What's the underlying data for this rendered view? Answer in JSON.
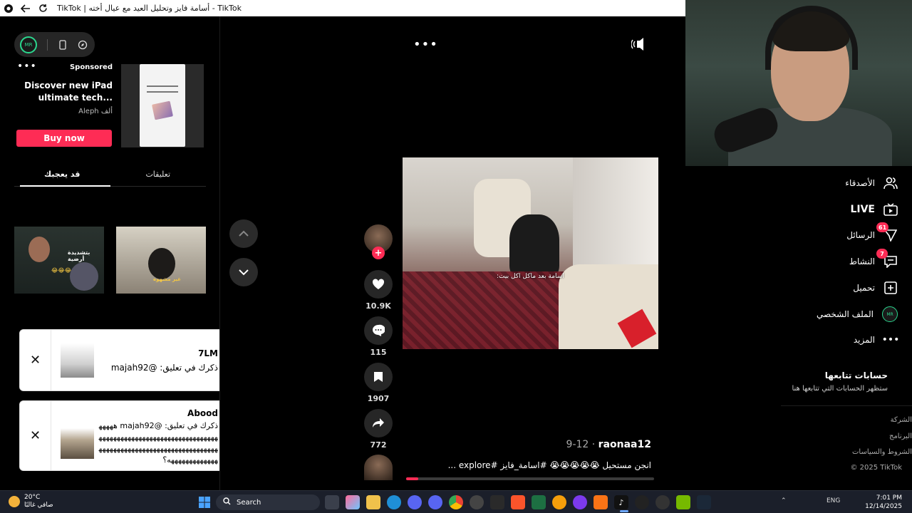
{
  "browser": {
    "tab_title": "TikTok | أسامة فايز وتحليل العيد مع عيال أخته - TikTok"
  },
  "ad": {
    "sponsored": "Sponsored",
    "headline": "Discover new iPad ultimate tech...",
    "brand": "Aleph ألف",
    "buy_label": "Buy now"
  },
  "tabs": [
    {
      "label": "تعليقات"
    },
    {
      "label": "قد يعجبك"
    }
  ],
  "recommended": [
    {
      "caption": "بتشديدة أرضية"
    },
    {
      "caption": "غير مشهوه"
    }
  ],
  "notifications": [
    {
      "name": "7LM",
      "text": "ذكرك في تعليق: @majah92"
    },
    {
      "name": "Abood",
      "text": "ذكرك في تعليق: @majah92 ههههههههههههههههههههههههههههههههههههههههههههههههههههههههههههههههههههههههههههههههههههه؟"
    }
  ],
  "video": {
    "caption": "اسامة بعد ماكل اكل بيت:",
    "author": "raonaa12",
    "date": "9-12",
    "description": "انجن مستحيل 😭😭😭😭😭 #اسامة_فايز #explore ...",
    "progress": 0.05
  },
  "actions": {
    "likes": "10.9K",
    "comments": "115",
    "saves": "1907",
    "shares": "772"
  },
  "right_nav": [
    {
      "label": "الأصدقاء",
      "icon": "friends-icon"
    },
    {
      "label": "LIVE",
      "icon": "live-tv-icon"
    },
    {
      "label": "الرسائل",
      "icon": "send-icon",
      "badge": "61"
    },
    {
      "label": "النشاط",
      "icon": "inbox-icon",
      "badge": "7"
    },
    {
      "label": "تحميل",
      "icon": "upload-plus-icon"
    },
    {
      "label": "الملف الشخصي",
      "icon": "profile-avatar"
    },
    {
      "label": "المزيد",
      "icon": "more-icon"
    }
  ],
  "following": {
    "heading": "حسابات تتابعها",
    "subtext": "ستظهر الحسابات التي تتابعها هنا"
  },
  "footer": [
    "الشركة",
    "البرنامج",
    "الشروط والسياسات",
    "© 2025 TikTok"
  ],
  "taskbar": {
    "temperature": "20°C",
    "weather_text": "صافي غالبًا",
    "search_label": "Search",
    "language": "ENG",
    "time": "7:01 PM",
    "date": "12/14/2025"
  },
  "colors": {
    "accent": "#fe2c55",
    "background": "#000000"
  }
}
